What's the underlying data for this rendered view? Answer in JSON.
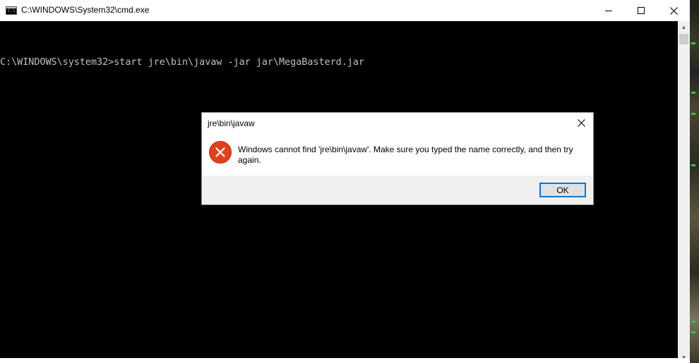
{
  "window": {
    "title": "C:\\WINDOWS\\System32\\cmd.exe",
    "app_icon_text": "C:\\",
    "controls": {
      "minimize": "minimize",
      "maximize": "maximize",
      "close": "close"
    }
  },
  "console": {
    "lines": [
      "C:\\WINDOWS\\system32>start jre\\bin\\javaw -jar jar\\MegaBasterd.jar"
    ],
    "text_color": "#c0c0c0",
    "background": "#000000"
  },
  "dialog": {
    "title": "jre\\bin\\javaw",
    "message": "Windows cannot find 'jre\\bin\\javaw'. Make sure you typed the name correctly, and then try again.",
    "ok_label": "OK",
    "icon": "error-icon",
    "accent": "#0078d7",
    "error_color": "#e2401c"
  }
}
